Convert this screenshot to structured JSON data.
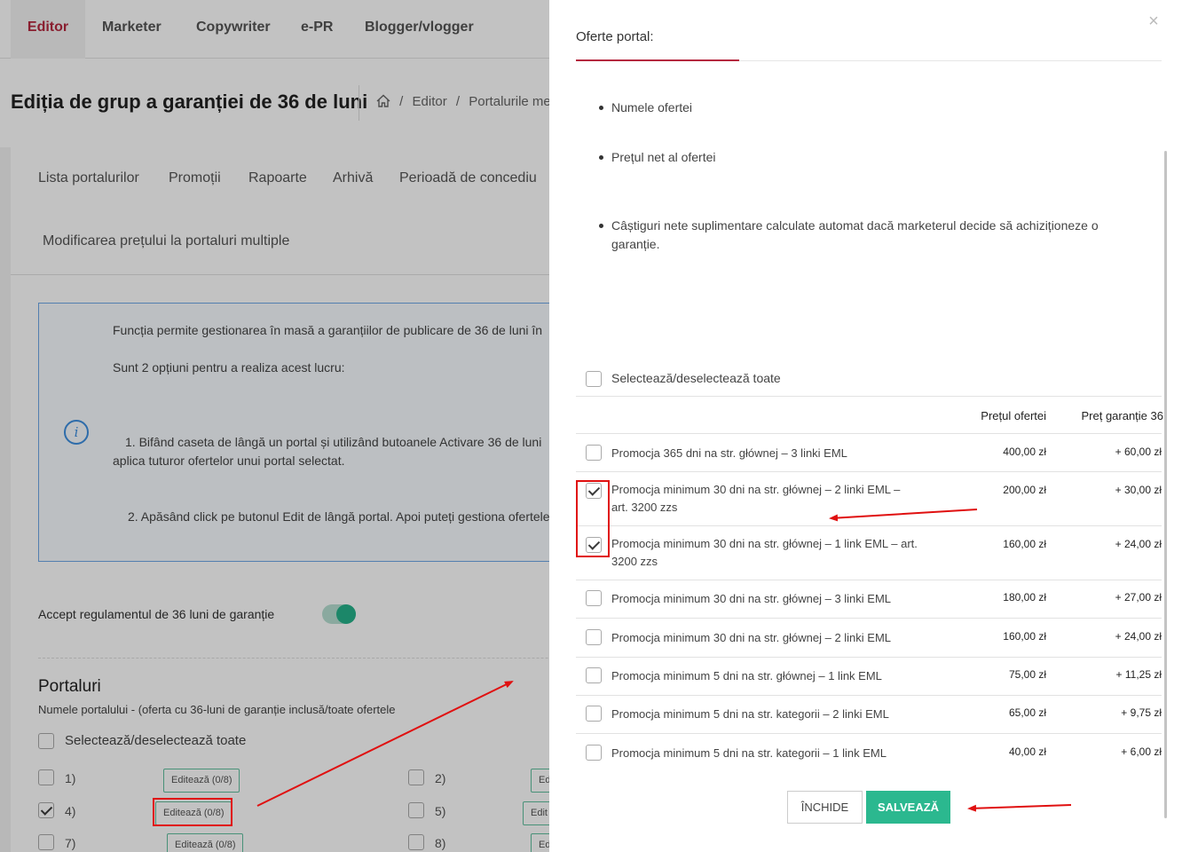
{
  "topnav": {
    "tabs": [
      "Editor",
      "Marketer",
      "Copywriter",
      "e-PR",
      "Blogger/vlogger"
    ]
  },
  "header": {
    "title": "Ediția de grup a garanției de 36 de luni",
    "breadcrumb": [
      "Editor",
      "Portalurile mele"
    ]
  },
  "subtabs": [
    "Lista portalurilor",
    "Promoții",
    "Rapoarte",
    "Arhivă",
    "Perioadă de concediu",
    "Modificarea prețului la portaluri multiple"
  ],
  "info": {
    "line1": "Funcția permite gestionarea în masă a garanțiilor de publicare de 36 de luni în",
    "line2": "Sunt 2 opțiuni pentru a realiza acest lucru:",
    "line3": "1.  Bifând caseta de lângă un portal și utilizând butoanele Activare 36 de luni",
    "line4": "aplica tuturor ofertelor unui portal selectat.",
    "line5": "2. Apăsând click pe butonul Edit de lângă portal. Apoi puteți gestiona ofertele"
  },
  "accept": {
    "label": "Accept regulamentul de 36 luni de garanție",
    "on": true
  },
  "portals": {
    "title": "Portaluri",
    "subtitle": "Numele portalului - (oferta cu 36-luni de garanție inclusă/toate ofertele",
    "select_all": "Selectează/deselectează toate",
    "items": [
      {
        "num": "1)",
        "checked": false,
        "edit": "Editează (0/8)"
      },
      {
        "num": "2)",
        "checked": false,
        "edit": "Ed"
      },
      {
        "num": "4)",
        "checked": true,
        "edit": "Editează (0/8)"
      },
      {
        "num": "5)",
        "checked": false,
        "edit": "Edit"
      },
      {
        "num": "7)",
        "checked": false,
        "edit": "Editează (0/8)"
      },
      {
        "num": "8)",
        "checked": false,
        "edit": "Ed"
      }
    ]
  },
  "panel": {
    "title": "Oferte portal:",
    "bullets": [
      "Numele ofertei",
      "Prețul net al ofertei",
      "Câștiguri nete suplimentare calculate automat dacă marketerul decide să achiziționeze o",
      "garanție."
    ],
    "select_all": "Selectează/deselectează toate",
    "columns": {
      "price": "Prețul ofertei",
      "guarantee": "Preț garanție 36"
    },
    "offers": [
      {
        "name": "Promocja 365 dni na str. głównej – 3 linki EML",
        "name2": "",
        "price": "400,00 zł",
        "guarantee": "+ 60,00 zł",
        "checked": false
      },
      {
        "name": "Promocja minimum 30 dni na str. głównej – 2 linki EML –",
        "name2": "art. 3200 zzs",
        "price": "200,00 zł",
        "guarantee": "+ 30,00 zł",
        "checked": true
      },
      {
        "name": "Promocja minimum 30 dni na str. głównej – 1 link EML – art.",
        "name2": "3200 zzs",
        "price": "160,00 zł",
        "guarantee": "+ 24,00 zł",
        "checked": true
      },
      {
        "name": "Promocja minimum 30 dni na str. głównej – 3 linki EML",
        "name2": "",
        "price": "180,00 zł",
        "guarantee": "+ 27,00 zł",
        "checked": false
      },
      {
        "name": "Promocja minimum 30 dni na str. głównej – 2 linki EML",
        "name2": "",
        "price": "160,00 zł",
        "guarantee": "+ 24,00 zł",
        "checked": false
      },
      {
        "name": "Promocja minimum 5 dni na str. głównej – 1 link EML",
        "name2": "",
        "price": "75,00 zł",
        "guarantee": "+ 11,25 zł",
        "checked": false
      },
      {
        "name": "Promocja minimum 5 dni na str. kategorii – 2 linki EML",
        "name2": "",
        "price": "65,00 zł",
        "guarantee": "+ 9,75 zł",
        "checked": false
      },
      {
        "name": "Promocja minimum 5 dni na str. kategorii – 1 link EML",
        "name2": "",
        "price": "40,00 zł",
        "guarantee": "+ 6,00 zł",
        "checked": false
      }
    ],
    "buttons": {
      "close": "ÎNCHIDE",
      "save": "SALVEAZĂ"
    }
  },
  "colors": {
    "accent": "#b5283f",
    "primary": "#2bb88f",
    "annotation": "#e01010"
  }
}
